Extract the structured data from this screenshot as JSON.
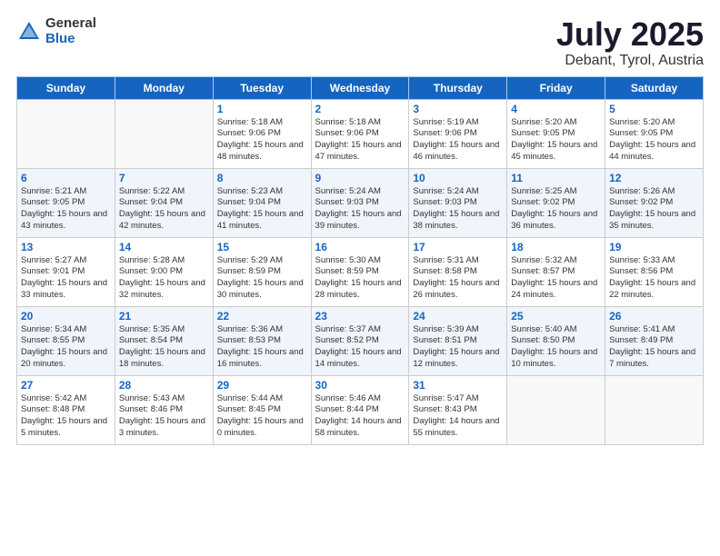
{
  "header": {
    "logo_general": "General",
    "logo_blue": "Blue",
    "month_title": "July 2025",
    "location": "Debant, Tyrol, Austria"
  },
  "days_of_week": [
    "Sunday",
    "Monday",
    "Tuesday",
    "Wednesday",
    "Thursday",
    "Friday",
    "Saturday"
  ],
  "weeks": [
    {
      "shaded": false,
      "days": [
        {
          "num": "",
          "sunrise": "",
          "sunset": "",
          "daylight": ""
        },
        {
          "num": "",
          "sunrise": "",
          "sunset": "",
          "daylight": ""
        },
        {
          "num": "1",
          "sunrise": "Sunrise: 5:18 AM",
          "sunset": "Sunset: 9:06 PM",
          "daylight": "Daylight: 15 hours and 48 minutes."
        },
        {
          "num": "2",
          "sunrise": "Sunrise: 5:18 AM",
          "sunset": "Sunset: 9:06 PM",
          "daylight": "Daylight: 15 hours and 47 minutes."
        },
        {
          "num": "3",
          "sunrise": "Sunrise: 5:19 AM",
          "sunset": "Sunset: 9:06 PM",
          "daylight": "Daylight: 15 hours and 46 minutes."
        },
        {
          "num": "4",
          "sunrise": "Sunrise: 5:20 AM",
          "sunset": "Sunset: 9:05 PM",
          "daylight": "Daylight: 15 hours and 45 minutes."
        },
        {
          "num": "5",
          "sunrise": "Sunrise: 5:20 AM",
          "sunset": "Sunset: 9:05 PM",
          "daylight": "Daylight: 15 hours and 44 minutes."
        }
      ]
    },
    {
      "shaded": true,
      "days": [
        {
          "num": "6",
          "sunrise": "Sunrise: 5:21 AM",
          "sunset": "Sunset: 9:05 PM",
          "daylight": "Daylight: 15 hours and 43 minutes."
        },
        {
          "num": "7",
          "sunrise": "Sunrise: 5:22 AM",
          "sunset": "Sunset: 9:04 PM",
          "daylight": "Daylight: 15 hours and 42 minutes."
        },
        {
          "num": "8",
          "sunrise": "Sunrise: 5:23 AM",
          "sunset": "Sunset: 9:04 PM",
          "daylight": "Daylight: 15 hours and 41 minutes."
        },
        {
          "num": "9",
          "sunrise": "Sunrise: 5:24 AM",
          "sunset": "Sunset: 9:03 PM",
          "daylight": "Daylight: 15 hours and 39 minutes."
        },
        {
          "num": "10",
          "sunrise": "Sunrise: 5:24 AM",
          "sunset": "Sunset: 9:03 PM",
          "daylight": "Daylight: 15 hours and 38 minutes."
        },
        {
          "num": "11",
          "sunrise": "Sunrise: 5:25 AM",
          "sunset": "Sunset: 9:02 PM",
          "daylight": "Daylight: 15 hours and 36 minutes."
        },
        {
          "num": "12",
          "sunrise": "Sunrise: 5:26 AM",
          "sunset": "Sunset: 9:02 PM",
          "daylight": "Daylight: 15 hours and 35 minutes."
        }
      ]
    },
    {
      "shaded": false,
      "days": [
        {
          "num": "13",
          "sunrise": "Sunrise: 5:27 AM",
          "sunset": "Sunset: 9:01 PM",
          "daylight": "Daylight: 15 hours and 33 minutes."
        },
        {
          "num": "14",
          "sunrise": "Sunrise: 5:28 AM",
          "sunset": "Sunset: 9:00 PM",
          "daylight": "Daylight: 15 hours and 32 minutes."
        },
        {
          "num": "15",
          "sunrise": "Sunrise: 5:29 AM",
          "sunset": "Sunset: 8:59 PM",
          "daylight": "Daylight: 15 hours and 30 minutes."
        },
        {
          "num": "16",
          "sunrise": "Sunrise: 5:30 AM",
          "sunset": "Sunset: 8:59 PM",
          "daylight": "Daylight: 15 hours and 28 minutes."
        },
        {
          "num": "17",
          "sunrise": "Sunrise: 5:31 AM",
          "sunset": "Sunset: 8:58 PM",
          "daylight": "Daylight: 15 hours and 26 minutes."
        },
        {
          "num": "18",
          "sunrise": "Sunrise: 5:32 AM",
          "sunset": "Sunset: 8:57 PM",
          "daylight": "Daylight: 15 hours and 24 minutes."
        },
        {
          "num": "19",
          "sunrise": "Sunrise: 5:33 AM",
          "sunset": "Sunset: 8:56 PM",
          "daylight": "Daylight: 15 hours and 22 minutes."
        }
      ]
    },
    {
      "shaded": true,
      "days": [
        {
          "num": "20",
          "sunrise": "Sunrise: 5:34 AM",
          "sunset": "Sunset: 8:55 PM",
          "daylight": "Daylight: 15 hours and 20 minutes."
        },
        {
          "num": "21",
          "sunrise": "Sunrise: 5:35 AM",
          "sunset": "Sunset: 8:54 PM",
          "daylight": "Daylight: 15 hours and 18 minutes."
        },
        {
          "num": "22",
          "sunrise": "Sunrise: 5:36 AM",
          "sunset": "Sunset: 8:53 PM",
          "daylight": "Daylight: 15 hours and 16 minutes."
        },
        {
          "num": "23",
          "sunrise": "Sunrise: 5:37 AM",
          "sunset": "Sunset: 8:52 PM",
          "daylight": "Daylight: 15 hours and 14 minutes."
        },
        {
          "num": "24",
          "sunrise": "Sunrise: 5:39 AM",
          "sunset": "Sunset: 8:51 PM",
          "daylight": "Daylight: 15 hours and 12 minutes."
        },
        {
          "num": "25",
          "sunrise": "Sunrise: 5:40 AM",
          "sunset": "Sunset: 8:50 PM",
          "daylight": "Daylight: 15 hours and 10 minutes."
        },
        {
          "num": "26",
          "sunrise": "Sunrise: 5:41 AM",
          "sunset": "Sunset: 8:49 PM",
          "daylight": "Daylight: 15 hours and 7 minutes."
        }
      ]
    },
    {
      "shaded": false,
      "days": [
        {
          "num": "27",
          "sunrise": "Sunrise: 5:42 AM",
          "sunset": "Sunset: 8:48 PM",
          "daylight": "Daylight: 15 hours and 5 minutes."
        },
        {
          "num": "28",
          "sunrise": "Sunrise: 5:43 AM",
          "sunset": "Sunset: 8:46 PM",
          "daylight": "Daylight: 15 hours and 3 minutes."
        },
        {
          "num": "29",
          "sunrise": "Sunrise: 5:44 AM",
          "sunset": "Sunset: 8:45 PM",
          "daylight": "Daylight: 15 hours and 0 minutes."
        },
        {
          "num": "30",
          "sunrise": "Sunrise: 5:46 AM",
          "sunset": "Sunset: 8:44 PM",
          "daylight": "Daylight: 14 hours and 58 minutes."
        },
        {
          "num": "31",
          "sunrise": "Sunrise: 5:47 AM",
          "sunset": "Sunset: 8:43 PM",
          "daylight": "Daylight: 14 hours and 55 minutes."
        },
        {
          "num": "",
          "sunrise": "",
          "sunset": "",
          "daylight": ""
        },
        {
          "num": "",
          "sunrise": "",
          "sunset": "",
          "daylight": ""
        }
      ]
    }
  ]
}
